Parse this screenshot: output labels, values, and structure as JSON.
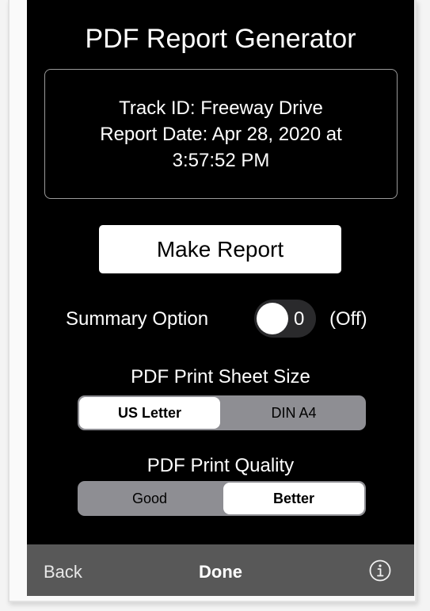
{
  "header": {
    "title": "PDF Report Generator"
  },
  "info": {
    "track_line": "Track ID: Freeway Drive",
    "date_line1": "Report Date: Apr 28, 2020 at",
    "date_line2": "3:57:52 PM"
  },
  "make_report_label": "Make Report",
  "summary": {
    "label": "Summary Option",
    "toggle_value": "0",
    "state_text": "(Off)",
    "enabled": false
  },
  "sheet_size": {
    "label": "PDF Print Sheet Size",
    "options": [
      "US Letter",
      "DIN A4"
    ],
    "selected": "US Letter"
  },
  "quality": {
    "label": "PDF Print Quality",
    "options": [
      "Good",
      "Better"
    ],
    "selected": "Better"
  },
  "bottom_bar": {
    "back_label": "Back",
    "done_label": "Done",
    "info_icon": "info-circle-icon"
  },
  "colors": {
    "background": "#000000",
    "bottom_bar": "#585858",
    "segment_track": "#8e8e93",
    "toggle_off": "#2a2a2c"
  }
}
